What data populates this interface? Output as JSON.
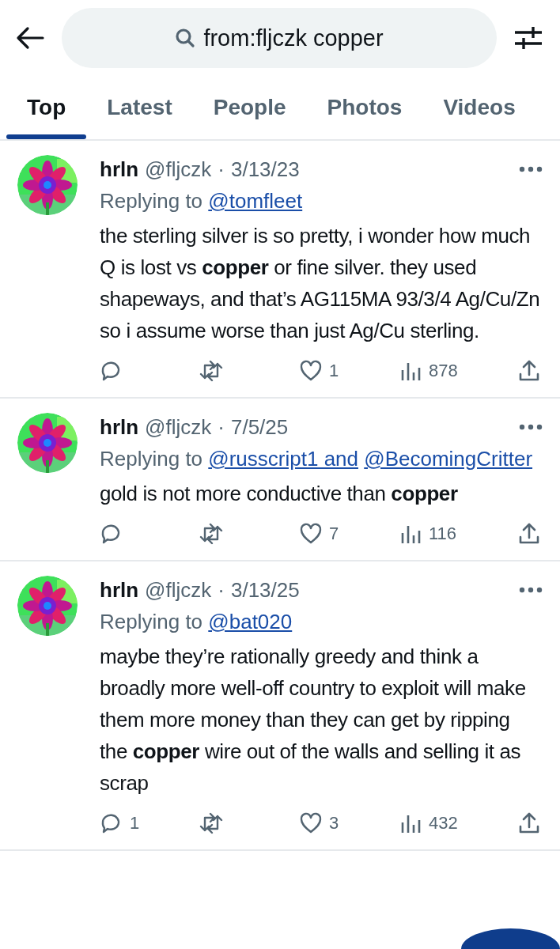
{
  "search": {
    "value": "from:fljczk copper"
  },
  "tabs": [
    {
      "label": "Top",
      "selected": true
    },
    {
      "label": "Latest",
      "selected": false
    },
    {
      "label": "People",
      "selected": false
    },
    {
      "label": "Photos",
      "selected": false
    },
    {
      "label": "Videos",
      "selected": false
    }
  ],
  "posts": [
    {
      "avatar": {
        "kind": "picture"
      },
      "name": "hrln",
      "handle": "@fljczk",
      "separator": "·",
      "date": "3/13/23",
      "replying_prefix": "Replying to",
      "reply_to": [
        "@tomfleet"
      ],
      "text": "the sterling silver is so pretty, i wonder how much Q is lost vs **copper** or fine silver. they used shapeways, and that’s AG115MA 93/3/4 Ag/Cu/Zn so i assume worse than just Ag/Cu sterling.",
      "likes": "1",
      "views": "878"
    },
    {
      "avatar": {
        "kind": "picture"
      },
      "name": "hrln",
      "handle": "@fljczk",
      "separator": "·",
      "date": "7/5/25",
      "replying_prefix": "Replying to",
      "reply_to": [
        "@russcript1 and",
        "@BecomingCritter"
      ],
      "text": "gold is not more conductive than **copper**",
      "likes": "7",
      "views": "116"
    },
    {
      "avatar": {
        "kind": "picture"
      },
      "name": "hrln",
      "handle": "@fljczk",
      "separator": "·",
      "date": "3/13/25",
      "replying_prefix": "Replying to",
      "reply_to": [
        "@bat020"
      ],
      "text": "maybe they’re rationally greedy and think a broadly more well-off country to exploit will make them more money than they can get by ripping the **copper** wire out of the walls and selling it as scrap",
      "replies": "1",
      "likes": "3",
      "views": "432"
    }
  ]
}
